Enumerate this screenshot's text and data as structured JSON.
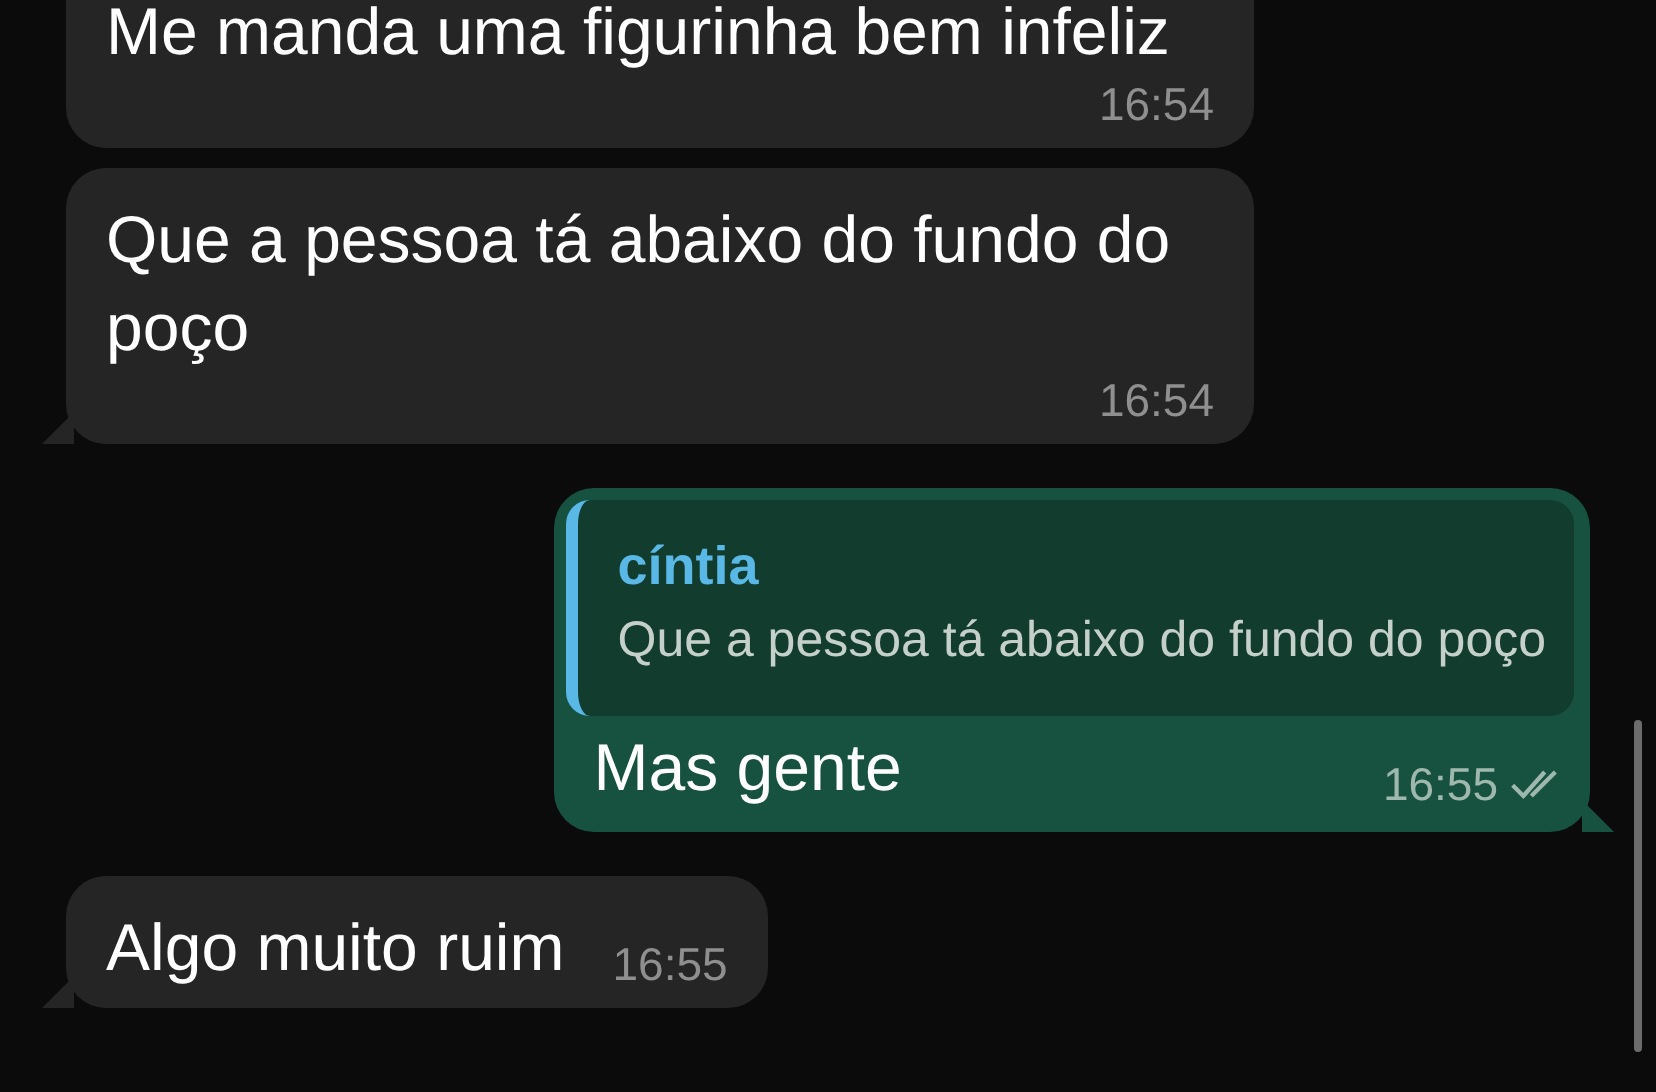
{
  "messages": [
    {
      "kind": "incoming",
      "text": "Me manda uma figurinha bem infeliz",
      "time": "16:54",
      "tail": false
    },
    {
      "kind": "incoming",
      "text": "Que a pessoa tá abaixo do fundo do poço",
      "time": "16:54",
      "tail": true
    },
    {
      "kind": "outgoing",
      "reply": {
        "author": "cíntia",
        "text": "Que a pessoa tá abaixo do fundo do poço"
      },
      "text": "Mas gente",
      "time": "16:55",
      "read": false,
      "tail": true
    },
    {
      "kind": "incoming",
      "text": "Algo muito ruim",
      "time": "16:55",
      "tail": true
    }
  ]
}
